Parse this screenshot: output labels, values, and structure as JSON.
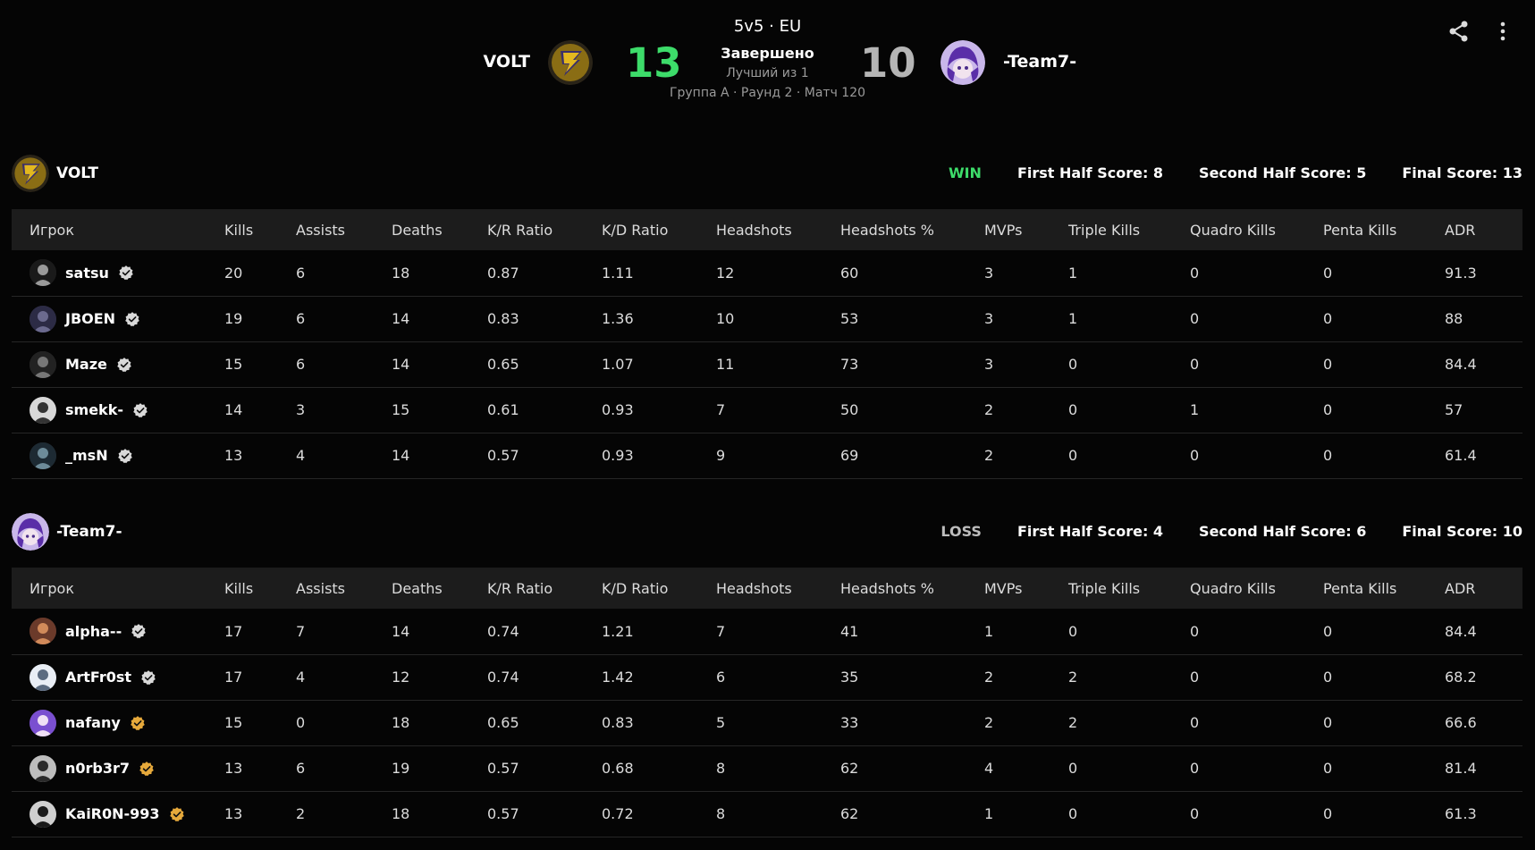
{
  "header": {
    "title": "5v5 · EU",
    "status": "Завершено",
    "best_of": "Лучший из 1",
    "info": "Группа A · Раунд 2 · Матч 120",
    "left_team": "VOLT",
    "right_team": "-Team7-",
    "left_score": "13",
    "right_score": "10",
    "share_icon": "share-icon",
    "more_icon": "more-vertical-icon"
  },
  "columns": [
    "Игрок",
    "Kills",
    "Assists",
    "Deaths",
    "K/R Ratio",
    "K/D Ratio",
    "Headshots",
    "Headshots %",
    "MVPs",
    "Triple Kills",
    "Quadro Kills",
    "Penta Kills",
    "ADR"
  ],
  "teams": [
    {
      "name": "VOLT",
      "result": "WIN",
      "first_half": "First Half Score: 8",
      "second_half": "Second Half Score: 5",
      "final": "Final Score: 13",
      "players": [
        {
          "name": "satsu",
          "verify": "verified-gray",
          "stats": [
            "20",
            "6",
            "18",
            "0.87",
            "1.11",
            "12",
            "60",
            "3",
            "1",
            "0",
            "0",
            "91.3"
          ]
        },
        {
          "name": "JBOEN",
          "verify": "verified-gray",
          "stats": [
            "19",
            "6",
            "14",
            "0.83",
            "1.36",
            "10",
            "53",
            "3",
            "1",
            "0",
            "0",
            "88"
          ]
        },
        {
          "name": "Maze",
          "verify": "verified-gray",
          "stats": [
            "15",
            "6",
            "14",
            "0.65",
            "1.07",
            "11",
            "73",
            "3",
            "0",
            "0",
            "0",
            "84.4"
          ]
        },
        {
          "name": "smekk-",
          "verify": "verified-gray",
          "stats": [
            "14",
            "3",
            "15",
            "0.61",
            "0.93",
            "7",
            "50",
            "2",
            "0",
            "1",
            "0",
            "57"
          ]
        },
        {
          "name": "_msN",
          "verify": "verified-gray",
          "stats": [
            "13",
            "4",
            "14",
            "0.57",
            "0.93",
            "9",
            "69",
            "2",
            "0",
            "0",
            "0",
            "61.4"
          ]
        }
      ]
    },
    {
      "name": "-Team7-",
      "result": "LOSS",
      "first_half": "First Half Score: 4",
      "second_half": "Second Half Score: 6",
      "final": "Final Score: 10",
      "players": [
        {
          "name": "alpha--",
          "verify": "verified-gray",
          "stats": [
            "17",
            "7",
            "14",
            "0.74",
            "1.21",
            "7",
            "41",
            "1",
            "0",
            "0",
            "0",
            "84.4"
          ]
        },
        {
          "name": "ArtFr0st",
          "verify": "verified-gray",
          "stats": [
            "17",
            "4",
            "12",
            "0.74",
            "1.42",
            "6",
            "35",
            "2",
            "2",
            "0",
            "0",
            "68.2"
          ]
        },
        {
          "name": "nafany",
          "verify": "verified-gold",
          "stats": [
            "15",
            "0",
            "18",
            "0.65",
            "0.83",
            "5",
            "33",
            "2",
            "2",
            "0",
            "0",
            "66.6"
          ]
        },
        {
          "name": "n0rb3r7",
          "verify": "verified-gold",
          "stats": [
            "13",
            "6",
            "19",
            "0.57",
            "0.68",
            "8",
            "62",
            "4",
            "0",
            "0",
            "0",
            "81.4"
          ]
        },
        {
          "name": "KaiR0N-993",
          "verify": "verified-gold",
          "stats": [
            "13",
            "2",
            "18",
            "0.57",
            "0.72",
            "8",
            "62",
            "1",
            "0",
            "0",
            "0",
            "61.3"
          ]
        }
      ]
    }
  ],
  "colors": {
    "win": "#3ddc6a",
    "loss": "#bdbdbd",
    "verified_gray": "#d9d9d9",
    "verified_gold": "#e6a93b"
  }
}
